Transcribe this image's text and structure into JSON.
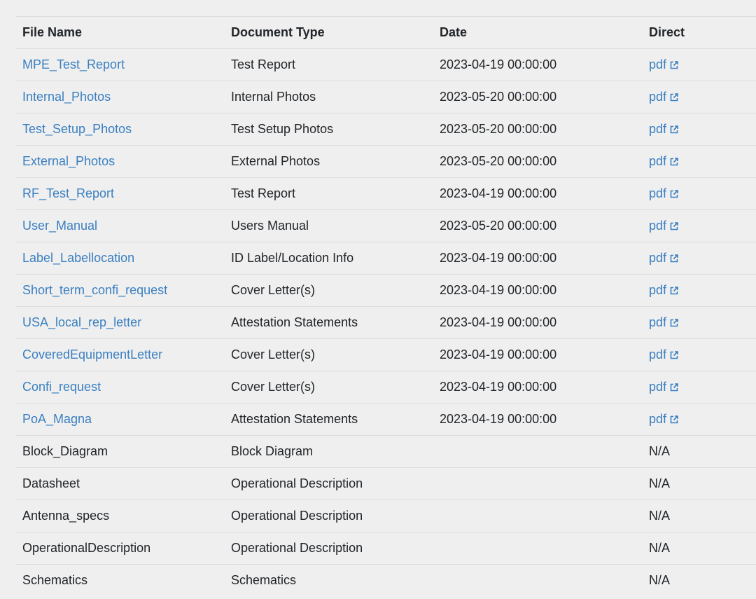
{
  "table": {
    "headers": {
      "file_name": "File Name",
      "doc_type": "Document Type",
      "date": "Date",
      "direct": "Direct"
    },
    "rows": [
      {
        "file": "MPE_Test_Report",
        "type": "Test Report",
        "date": "2023-04-19 00:00:00",
        "direct": "pdf",
        "linked": true
      },
      {
        "file": "Internal_Photos",
        "type": "Internal Photos",
        "date": "2023-05-20 00:00:00",
        "direct": "pdf",
        "linked": true
      },
      {
        "file": "Test_Setup_Photos",
        "type": "Test Setup Photos",
        "date": "2023-05-20 00:00:00",
        "direct": "pdf",
        "linked": true
      },
      {
        "file": "External_Photos",
        "type": "External Photos",
        "date": "2023-05-20 00:00:00",
        "direct": "pdf",
        "linked": true
      },
      {
        "file": "RF_Test_Report",
        "type": "Test Report",
        "date": "2023-04-19 00:00:00",
        "direct": "pdf",
        "linked": true
      },
      {
        "file": "User_Manual",
        "type": "Users Manual",
        "date": "2023-05-20 00:00:00",
        "direct": "pdf",
        "linked": true
      },
      {
        "file": "Label_Labellocation",
        "type": "ID Label/Location Info",
        "date": "2023-04-19 00:00:00",
        "direct": "pdf",
        "linked": true
      },
      {
        "file": "Short_term_confi_request",
        "type": "Cover Letter(s)",
        "date": "2023-04-19 00:00:00",
        "direct": "pdf",
        "linked": true
      },
      {
        "file": "USA_local_rep_letter",
        "type": "Attestation Statements",
        "date": "2023-04-19 00:00:00",
        "direct": "pdf",
        "linked": true
      },
      {
        "file": "CoveredEquipmentLetter",
        "type": "Cover Letter(s)",
        "date": "2023-04-19 00:00:00",
        "direct": "pdf",
        "linked": true
      },
      {
        "file": "Confi_request",
        "type": "Cover Letter(s)",
        "date": "2023-04-19 00:00:00",
        "direct": "pdf",
        "linked": true
      },
      {
        "file": "PoA_Magna",
        "type": "Attestation Statements",
        "date": "2023-04-19 00:00:00",
        "direct": "pdf",
        "linked": true
      },
      {
        "file": "Block_Diagram",
        "type": "Block Diagram",
        "date": "",
        "direct": "N/A",
        "linked": false
      },
      {
        "file": "Datasheet",
        "type": "Operational Description",
        "date": "",
        "direct": "N/A",
        "linked": false
      },
      {
        "file": "Antenna_specs",
        "type": "Operational Description",
        "date": "",
        "direct": "N/A",
        "linked": false
      },
      {
        "file": "OperationalDescription",
        "type": "Operational Description",
        "date": "",
        "direct": "N/A",
        "linked": false
      },
      {
        "file": "Schematics",
        "type": "Schematics",
        "date": "",
        "direct": "N/A",
        "linked": false
      }
    ]
  },
  "icons": {
    "external_link": "external-link-icon"
  },
  "colors": {
    "link": "#3a7fc1",
    "text": "#212529",
    "background": "#efefef",
    "divider": "#dcdcdc"
  }
}
